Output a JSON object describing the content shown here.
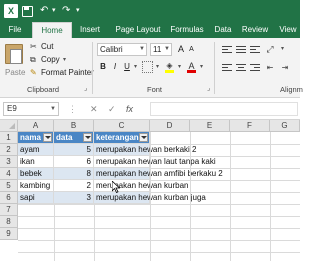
{
  "titlebar": {
    "logo": "X",
    "undo": "↶",
    "redo": "↷",
    "caret": "▾",
    "icons": [
      "excel-logo",
      "save-icon",
      "undo-icon",
      "redo-icon",
      "customize-qat-icon"
    ]
  },
  "tabs": [
    "File",
    "Home",
    "Insert",
    "Page Layout",
    "Formulas",
    "Data",
    "Review",
    "View"
  ],
  "active_tab": "Home",
  "ribbon": {
    "clipboard": {
      "paste_label": "Paste",
      "cut_label": "Cut",
      "copy_label": "Copy",
      "format_painter_label": "Format Painter",
      "group_label": "Clipboard"
    },
    "font": {
      "font_name": "Calibri",
      "font_size": "11",
      "bold": "B",
      "italic": "I",
      "underline": "U",
      "grow": "A",
      "shrink": "A",
      "font_color_glyph": "A",
      "group_label": "Font"
    },
    "alignment": {
      "group_label": "Alignm"
    }
  },
  "formula_bar": {
    "name_box": "E9",
    "cancel": "✕",
    "enter": "✓",
    "fx": "fx",
    "value": ""
  },
  "grid": {
    "columns": [
      "A",
      "B",
      "C",
      "D",
      "E",
      "F",
      "G"
    ],
    "rows": [
      "1",
      "2",
      "3",
      "4",
      "5",
      "6",
      "7",
      "8",
      "9"
    ],
    "table": {
      "headers": [
        "nama",
        "data",
        "keterangan"
      ],
      "rows": [
        [
          "ayam",
          "5",
          "merupakan hewan berkaki 2"
        ],
        [
          "ikan",
          "6",
          "merupakan hewan laut tanpa kaki"
        ],
        [
          "bebek",
          "8",
          "merupakan hewan amfibi berkaku 2"
        ],
        [
          "kambing",
          "2",
          "merupakan hewan kurban"
        ],
        [
          "sapi",
          "3",
          "merupakan hewan kurban juga"
        ]
      ]
    }
  },
  "colors": {
    "excel_green": "#217346",
    "table_header": "#4a86c5",
    "table_band": "#dce6f1"
  }
}
